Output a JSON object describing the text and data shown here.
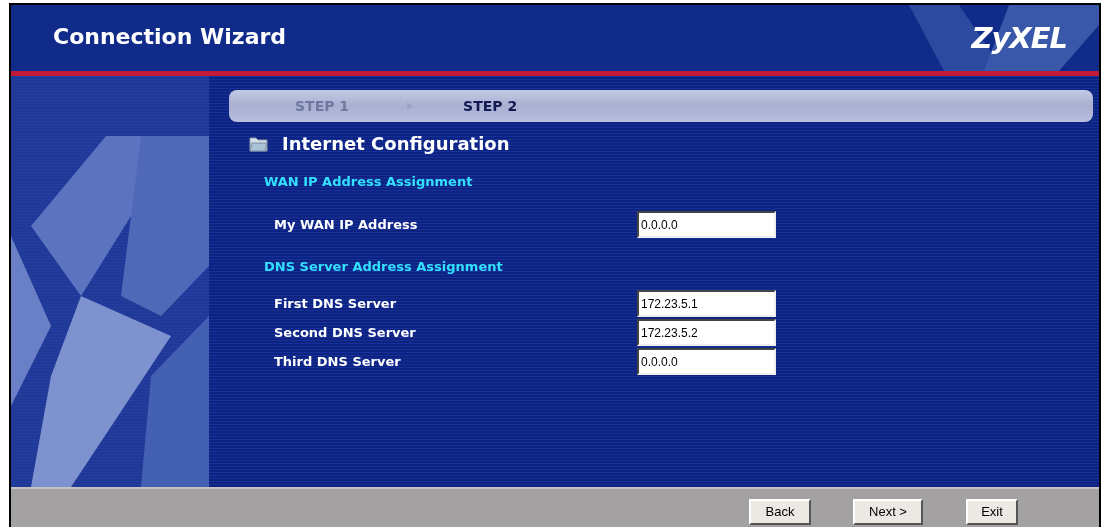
{
  "window": {
    "title": "Connection Wizard",
    "logo": "ZyXEL"
  },
  "steps": [
    {
      "label": "STEP 1",
      "selected": false
    },
    {
      "label": "STEP 2",
      "selected": true
    }
  ],
  "section": {
    "title": "Internet Configuration"
  },
  "groups": [
    {
      "heading": "WAN IP Address Assignment",
      "fields": [
        {
          "label": "My WAN IP Address",
          "value": "0.0.0.0"
        }
      ]
    },
    {
      "heading": "DNS Server Address Assignment",
      "fields": [
        {
          "label": "First DNS Server",
          "value": "172.23.5.1"
        },
        {
          "label": "Second DNS Server",
          "value": "172.23.5.2"
        },
        {
          "label": "Third DNS Server",
          "value": "0.0.0.0"
        }
      ]
    }
  ],
  "buttons": [
    "Back",
    "Next >",
    "Exit"
  ]
}
